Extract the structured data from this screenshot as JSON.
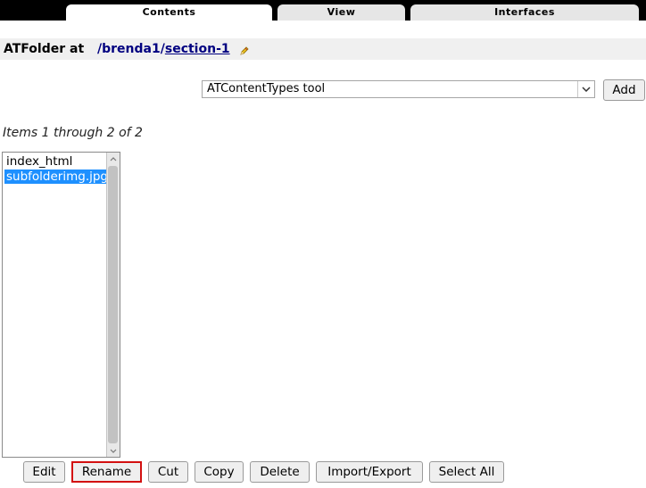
{
  "tabs": [
    {
      "label": "Contents",
      "active": true
    },
    {
      "label": "View",
      "active": false
    },
    {
      "label": "Interfaces",
      "active": false
    }
  ],
  "header": {
    "meta_type": "ATFolder at",
    "path_sep1": "/",
    "path_part1": "brenda1",
    "path_sep2": "/",
    "path_part2": "section-1",
    "edit_icon": "pencil-icon"
  },
  "add": {
    "selected_type": "ATContentTypes tool",
    "button_label": "Add"
  },
  "listing": {
    "count_text": "Items 1 through 2 of 2",
    "items": [
      {
        "label": "index_html",
        "selected": false
      },
      {
        "label": "subfolderimg.jpg",
        "selected": true
      }
    ]
  },
  "actions": {
    "edit": "Edit",
    "rename": "Rename",
    "cut": "Cut",
    "copy": "Copy",
    "delete": "Delete",
    "import_export": "Import/Export",
    "select_all": "Select All"
  },
  "colors": {
    "selection": "#1e90ff",
    "link": "#000080",
    "highlight_border": "#d31010"
  }
}
